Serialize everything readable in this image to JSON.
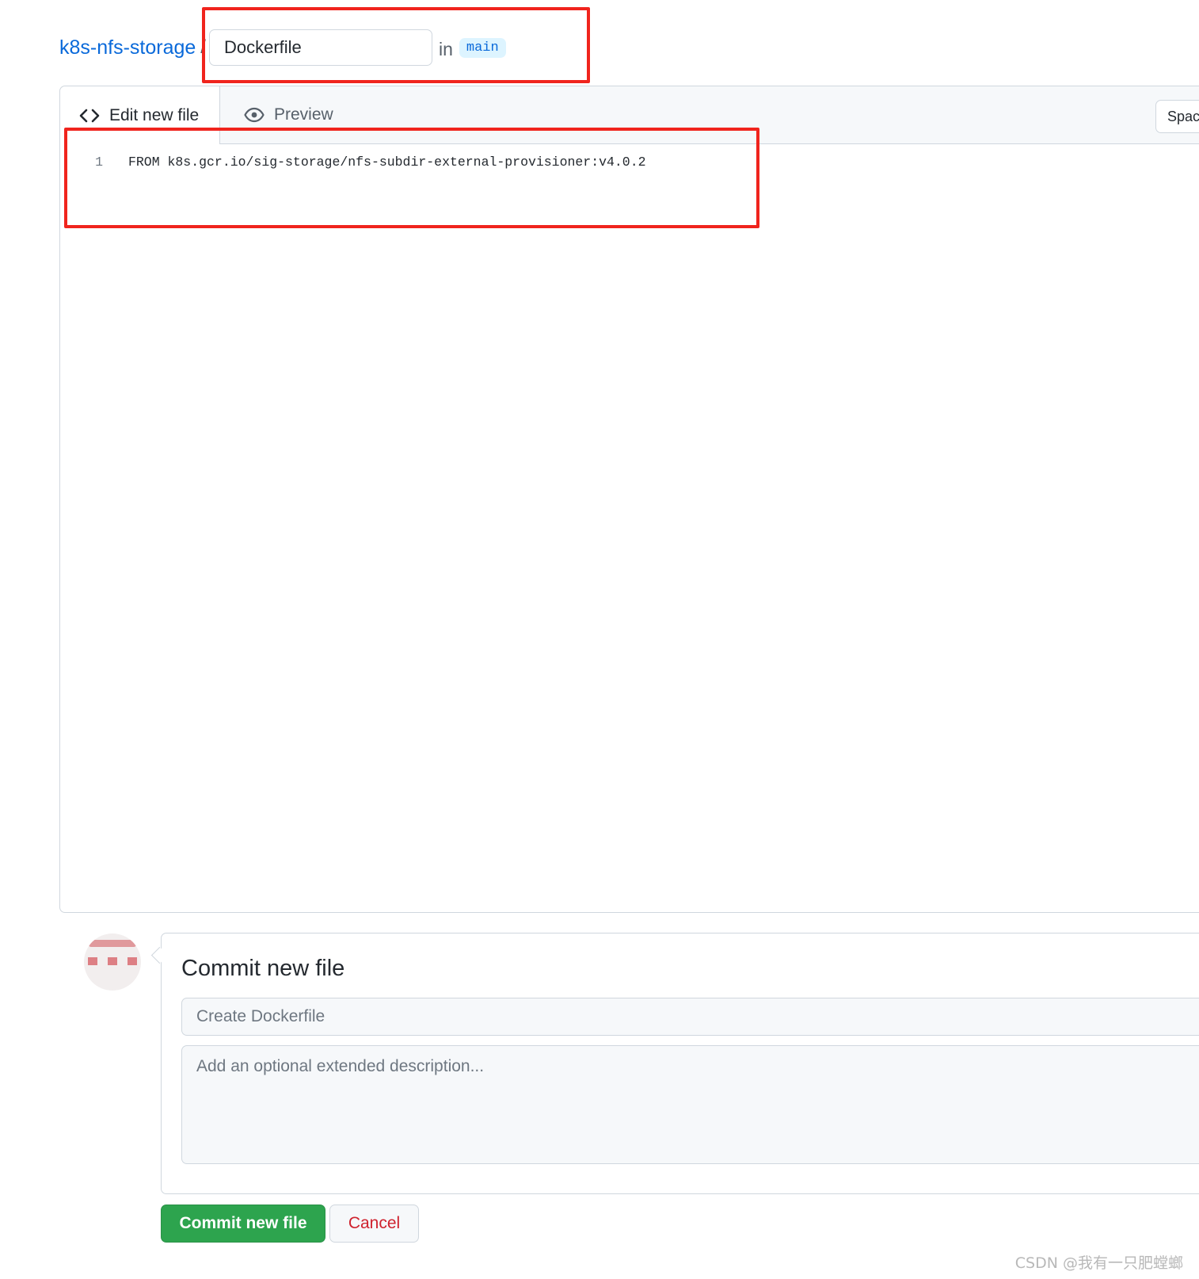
{
  "breadcrumb": {
    "repo_name": "k8s-nfs-storage",
    "separator": "/",
    "filename_value": "Dockerfile",
    "in_label": "in",
    "branch": "main"
  },
  "editor": {
    "tabs": [
      {
        "label": "Edit new file",
        "icon": "code-icon",
        "active": true
      },
      {
        "label": "Preview",
        "icon": "eye-icon",
        "active": false
      }
    ],
    "indent_mode": "Spaces",
    "lines": [
      {
        "number": "1",
        "text": "FROM k8s.gcr.io/sig-storage/nfs-subdir-external-provisioner:v4.0.2"
      }
    ]
  },
  "commit": {
    "title": "Commit new file",
    "summary_placeholder": "Create Dockerfile",
    "description_placeholder": "Add an optional extended description...",
    "commit_button": "Commit new file",
    "cancel_button": "Cancel"
  },
  "watermark": "CSDN @我有一只肥螳螂",
  "colors": {
    "link": "#0969da",
    "highlight": "#f0241d",
    "commit_green": "#2da44e",
    "cancel_red": "#cf222e"
  }
}
